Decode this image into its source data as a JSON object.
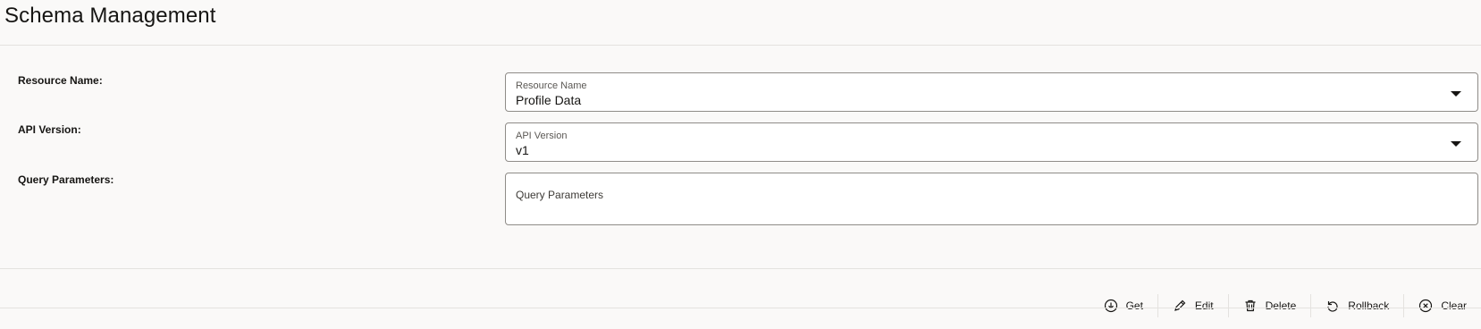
{
  "page": {
    "title": "Schema Management"
  },
  "form": {
    "resource_name": {
      "row_label": "Resource Name:",
      "field_label": "Resource Name",
      "value": "Profile Data"
    },
    "api_version": {
      "row_label": "API Version:",
      "field_label": "API Version",
      "value": "v1"
    },
    "query_parameters": {
      "row_label": "Query Parameters:",
      "placeholder": "Query Parameters",
      "value": ""
    }
  },
  "toolbar": {
    "get_label": "Get",
    "edit_label": "Edit",
    "delete_label": "Delete",
    "rollback_label": "Rollback",
    "clear_label": "Clear"
  },
  "icons": {
    "get": "download-circle-icon",
    "edit": "pencil-icon",
    "delete": "trash-icon",
    "rollback": "undo-icon",
    "clear": "close-circle-icon",
    "dropdown": "chevron-down-icon"
  },
  "colors": {
    "background": "#faf9f8",
    "border": "#8f8c88",
    "divider": "#e4e2df",
    "text": "#161513"
  }
}
